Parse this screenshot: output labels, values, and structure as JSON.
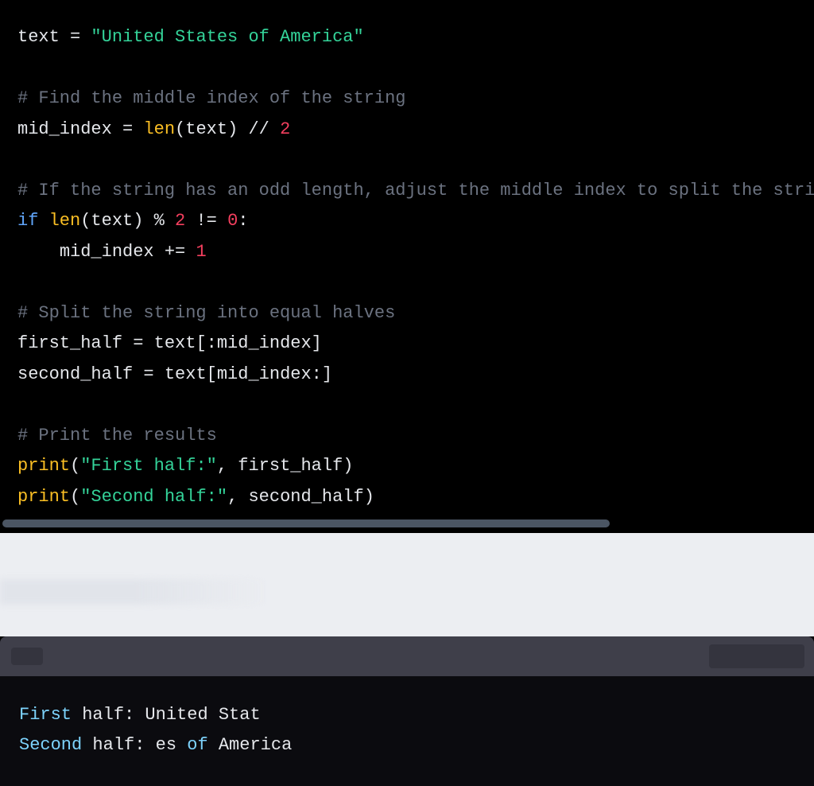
{
  "code": {
    "l1_var": "text",
    "l1_eq": " = ",
    "l1_str": "\"United States of America\"",
    "l3_com": "# Find the middle index of the string",
    "l4_var": "mid_index",
    "l4_eq": " = ",
    "l4_fn": "len",
    "l4_paren_open": "(",
    "l4_arg": "text",
    "l4_paren_close": ")",
    "l4_op": " // ",
    "l4_num": "2",
    "l6_com": "# If the string has an odd length, adjust the middle index to split the stri",
    "l7_if": "if",
    "l7_sp1": " ",
    "l7_fn": "len",
    "l7_po": "(",
    "l7_arg": "text",
    "l7_pc": ")",
    "l7_mod": " % ",
    "l7_n2": "2",
    "l7_neq": " != ",
    "l7_n0": "0",
    "l7_colon": ":",
    "l8_indent": "    ",
    "l8_var": "mid_index",
    "l8_op": " += ",
    "l8_num": "1",
    "l10_com": "# Split the string into equal halves",
    "l11_var": "first_half",
    "l11_eq": " = ",
    "l11_rhs": "text[:mid_index]",
    "l12_var": "second_half",
    "l12_eq": " = ",
    "l12_rhs": "text[mid_index:]",
    "l14_com": "# Print the results",
    "l15_fn": "print",
    "l15_po": "(",
    "l15_str": "\"First half:\"",
    "l15_comma": ", ",
    "l15_arg": "first_half",
    "l15_pc": ")",
    "l16_fn": "print",
    "l16_po": "(",
    "l16_str": "\"Second half:\"",
    "l16_comma": ", ",
    "l16_arg": "second_half",
    "l16_pc": ")"
  },
  "output": {
    "line1_hl": "First",
    "line1_rest": " half: United Stat",
    "line2_hl": "Second",
    "line2_rest_a": " half: es ",
    "line2_hl2": "of",
    "line2_rest_b": " America"
  }
}
